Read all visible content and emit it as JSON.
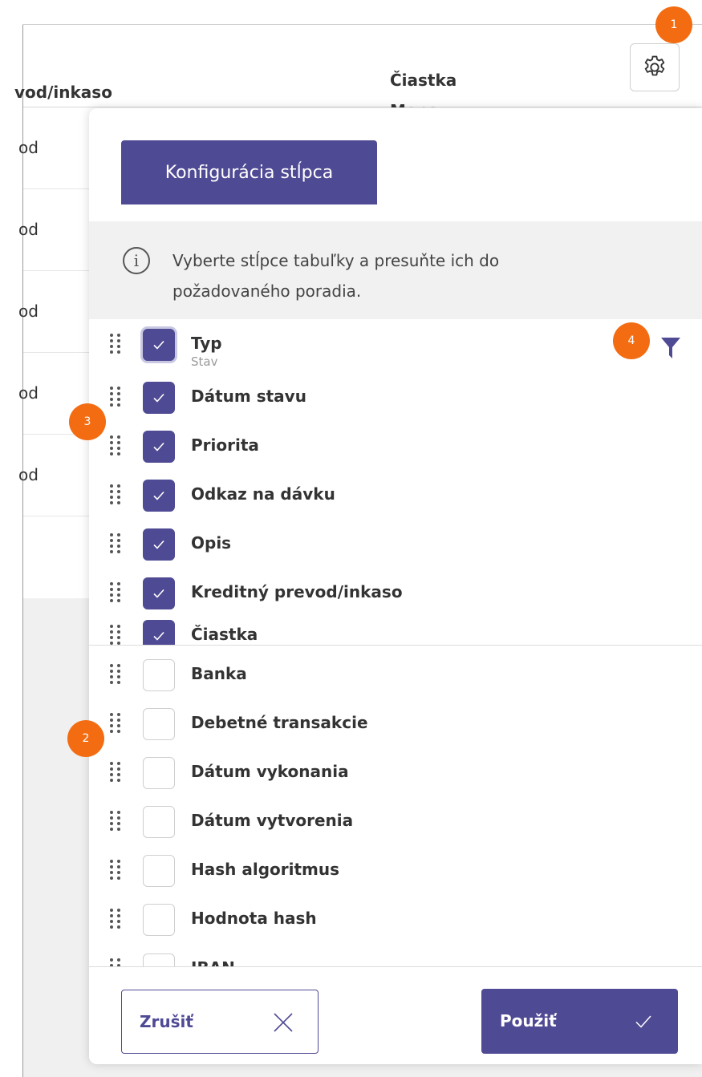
{
  "table": {
    "header_col_partial": "vod/inkaso",
    "header_amount_line1": "Čiastka",
    "header_amount_line2": "Mena",
    "rows": [
      "od",
      "od",
      "od",
      "od",
      "od"
    ]
  },
  "panel": {
    "title": "Konfigurácia stĺpca",
    "info_text": "Vyberte stĺpce tabuľky a presuňte ich do požadovaného poradia.",
    "selected_columns": [
      {
        "label": "Typ",
        "sublabel": "Stav",
        "checked": true
      },
      {
        "label": "Dátum stavu",
        "checked": true
      },
      {
        "label": "Priorita",
        "checked": true
      },
      {
        "label": "Odkaz na dávku",
        "checked": true
      },
      {
        "label": "Opis",
        "checked": true
      },
      {
        "label": "Kreditný prevod/inkaso",
        "checked": true
      },
      {
        "label": "Čiastka",
        "checked": true
      }
    ],
    "available_columns": [
      {
        "label": "Banka",
        "checked": false
      },
      {
        "label": "Debetné transakcie",
        "checked": false
      },
      {
        "label": "Dátum vykonania",
        "checked": false
      },
      {
        "label": "Dátum vytvorenia",
        "checked": false
      },
      {
        "label": "Hash algoritmus",
        "checked": false
      },
      {
        "label": "Hodnota hash",
        "checked": false
      },
      {
        "label": "IBAN",
        "checked": false
      }
    ],
    "cancel_label": "Zrušiť",
    "apply_label": "Použiť"
  },
  "markers": [
    "1",
    "2",
    "3",
    "4"
  ],
  "colors": {
    "accent": "#4f4a94",
    "marker": "#f36c12"
  }
}
